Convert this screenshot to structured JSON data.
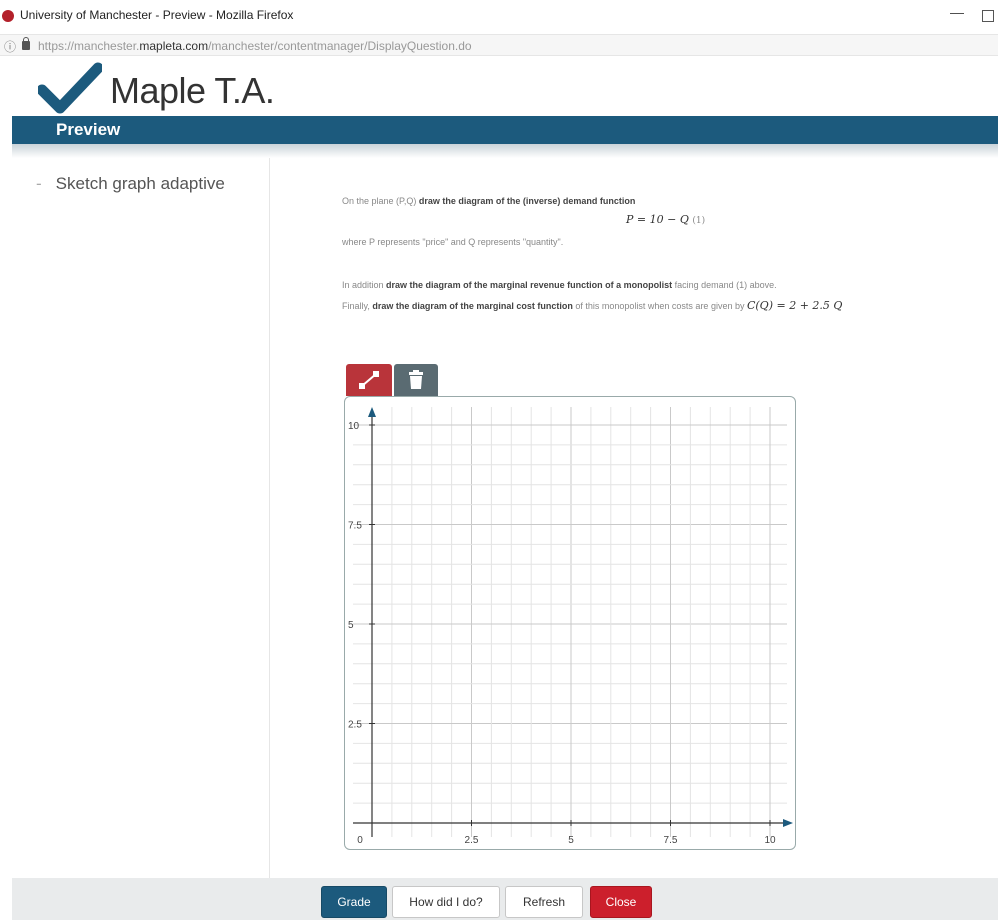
{
  "browser": {
    "window_title": "University of Manchester - Preview - Mozilla Firefox",
    "url_prefix": "https://manchester.",
    "url_host": "mapleta.com",
    "url_path": "/manchester/contentmanager/DisplayQuestion.do"
  },
  "header": {
    "logo_text": "Maple T.A.",
    "preview_label": "Preview"
  },
  "sidebar": {
    "items": [
      {
        "label": "Sketch graph adaptive"
      }
    ]
  },
  "question": {
    "line1_pre": "On the plane (P,Q) ",
    "line1_bold": "draw the diagram of the (inverse) demand function",
    "equation": "P = 10 − Q",
    "equation_tag": "(1)",
    "line2": "where P represents \"price\" and Q represents \"quantity\".",
    "line3_pre": "In addition ",
    "line3_bold": "draw the diagram of the marginal revenue function of a monopolist",
    "line3_post": " facing demand (1) above.",
    "line4_pre": "Finally, ",
    "line4_bold": "draw the diagram of the marginal cost function",
    "line4_post": " of this monopolist when costs are given by ",
    "line4_eq": "C(Q) = 2 + 2.5 Q"
  },
  "toolbar": {
    "draw_tool_icon": "line-draw-icon",
    "delete_tool_icon": "trash-icon"
  },
  "graph": {
    "x_ticks": [
      "0",
      "2.5",
      "5",
      "7.5",
      "10"
    ],
    "y_ticks": [
      "2.5",
      "5",
      "7.5",
      "10"
    ],
    "x_range": [
      0,
      10
    ],
    "y_range": [
      0,
      10
    ],
    "grid": true
  },
  "buttons": {
    "grade": "Grade",
    "how_did_i_do": "How did I do?",
    "refresh": "Refresh",
    "close": "Close"
  },
  "colors": {
    "brand_blue": "#1c5a7d",
    "close_red": "#cc1f2c",
    "draw_tool_red": "#b9343a"
  }
}
